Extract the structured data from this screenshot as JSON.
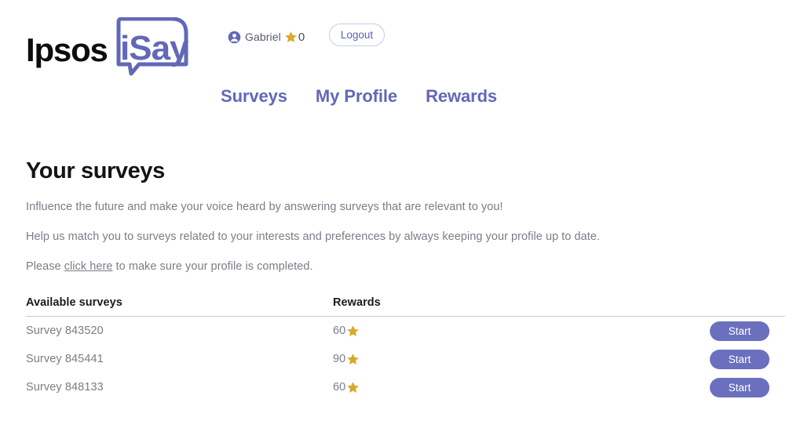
{
  "brand": {
    "logo_primary": "Ipsos",
    "logo_secondary": "iSay",
    "primary_color": "#6268b8",
    "button_color": "#6a70bd",
    "star_color": "#d9a92a",
    "text_muted": "#7c7c88"
  },
  "header": {
    "avatar_icon": "user-circle-icon",
    "user_name": "Gabriel",
    "star_icon": "star-icon",
    "points": "0",
    "logout_label": "Logout"
  },
  "nav": {
    "items": [
      {
        "label": "Surveys"
      },
      {
        "label": "My Profile"
      },
      {
        "label": "Rewards"
      }
    ]
  },
  "main": {
    "title": "Your surveys",
    "paragraphs": [
      "Influence the future and make your voice heard by answering surveys that are relevant to you!",
      "Help us match you to surveys related to your interests and preferences by always keeping your profile up to date."
    ],
    "profile_line": {
      "prefix": "Please ",
      "link_text": "click here",
      "suffix": " to make sure your profile is completed."
    }
  },
  "table": {
    "headers": {
      "survey": "Available surveys",
      "rewards": "Rewards"
    },
    "action_label": "Start",
    "rows": [
      {
        "name": "Survey 843520",
        "reward": "60",
        "star_icon": "star-icon",
        "action": "Start"
      },
      {
        "name": "Survey 845441",
        "reward": "90",
        "star_icon": "star-icon",
        "action": "Start"
      },
      {
        "name": "Survey 848133",
        "reward": "60",
        "star_icon": "star-icon",
        "action": "Start"
      }
    ]
  }
}
